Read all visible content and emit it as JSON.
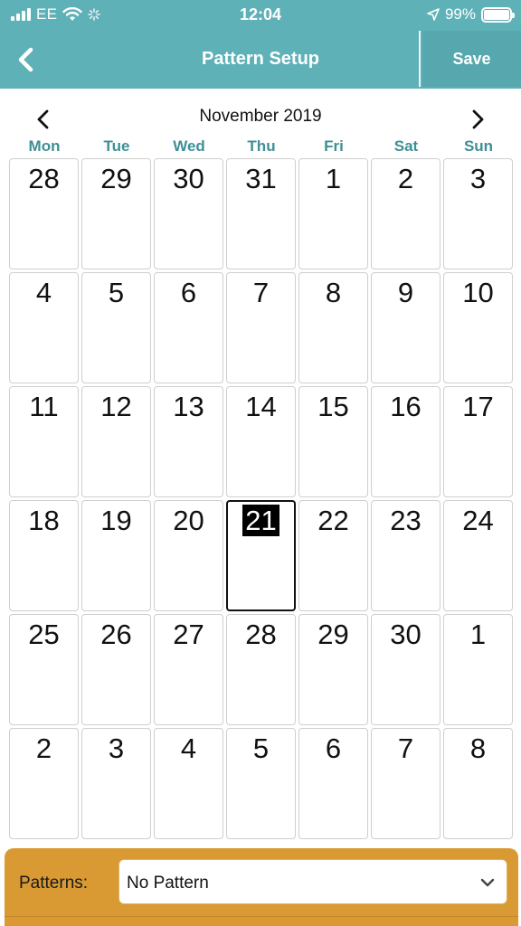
{
  "status_bar": {
    "carrier": "EE",
    "time": "12:04",
    "battery": "99%",
    "battery_level": 0.99
  },
  "nav": {
    "title": "Pattern Setup",
    "save_label": "Save",
    "back_icon": "chevron-left-icon"
  },
  "calendar": {
    "month_title": "November 2019",
    "weekdays": [
      "Mon",
      "Tue",
      "Wed",
      "Thu",
      "Fri",
      "Sat",
      "Sun"
    ],
    "weeks": [
      [
        "28",
        "29",
        "30",
        "31",
        "1",
        "2",
        "3"
      ],
      [
        "4",
        "5",
        "6",
        "7",
        "8",
        "9",
        "10"
      ],
      [
        "11",
        "12",
        "13",
        "14",
        "15",
        "16",
        "17"
      ],
      [
        "18",
        "19",
        "20",
        "21",
        "22",
        "23",
        "24"
      ],
      [
        "25",
        "26",
        "27",
        "28",
        "29",
        "30",
        "1"
      ],
      [
        "2",
        "3",
        "4",
        "5",
        "6",
        "7",
        "8"
      ]
    ],
    "selected_day": "21"
  },
  "patterns": {
    "label": "Patterns:",
    "selected": "No Pattern"
  },
  "colors": {
    "header": "#5fb1b8",
    "weekday": "#3e8f96",
    "patterns_bar": "#d99a33"
  }
}
